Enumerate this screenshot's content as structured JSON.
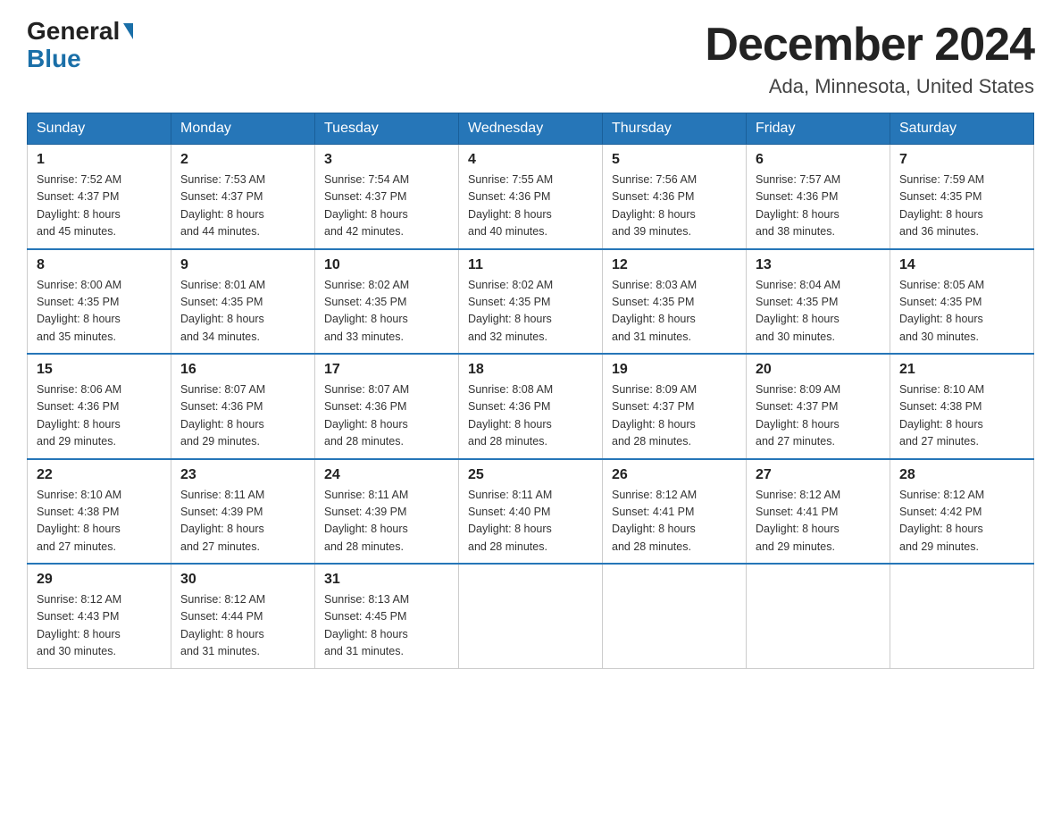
{
  "logo": {
    "general": "General",
    "blue": "Blue"
  },
  "header": {
    "month": "December 2024",
    "location": "Ada, Minnesota, United States"
  },
  "days_of_week": [
    "Sunday",
    "Monday",
    "Tuesday",
    "Wednesday",
    "Thursday",
    "Friday",
    "Saturday"
  ],
  "weeks": [
    [
      {
        "day": "1",
        "sunrise": "7:52 AM",
        "sunset": "4:37 PM",
        "daylight": "8 hours and 45 minutes."
      },
      {
        "day": "2",
        "sunrise": "7:53 AM",
        "sunset": "4:37 PM",
        "daylight": "8 hours and 44 minutes."
      },
      {
        "day": "3",
        "sunrise": "7:54 AM",
        "sunset": "4:37 PM",
        "daylight": "8 hours and 42 minutes."
      },
      {
        "day": "4",
        "sunrise": "7:55 AM",
        "sunset": "4:36 PM",
        "daylight": "8 hours and 40 minutes."
      },
      {
        "day": "5",
        "sunrise": "7:56 AM",
        "sunset": "4:36 PM",
        "daylight": "8 hours and 39 minutes."
      },
      {
        "day": "6",
        "sunrise": "7:57 AM",
        "sunset": "4:36 PM",
        "daylight": "8 hours and 38 minutes."
      },
      {
        "day": "7",
        "sunrise": "7:59 AM",
        "sunset": "4:35 PM",
        "daylight": "8 hours and 36 minutes."
      }
    ],
    [
      {
        "day": "8",
        "sunrise": "8:00 AM",
        "sunset": "4:35 PM",
        "daylight": "8 hours and 35 minutes."
      },
      {
        "day": "9",
        "sunrise": "8:01 AM",
        "sunset": "4:35 PM",
        "daylight": "8 hours and 34 minutes."
      },
      {
        "day": "10",
        "sunrise": "8:02 AM",
        "sunset": "4:35 PM",
        "daylight": "8 hours and 33 minutes."
      },
      {
        "day": "11",
        "sunrise": "8:02 AM",
        "sunset": "4:35 PM",
        "daylight": "8 hours and 32 minutes."
      },
      {
        "day": "12",
        "sunrise": "8:03 AM",
        "sunset": "4:35 PM",
        "daylight": "8 hours and 31 minutes."
      },
      {
        "day": "13",
        "sunrise": "8:04 AM",
        "sunset": "4:35 PM",
        "daylight": "8 hours and 30 minutes."
      },
      {
        "day": "14",
        "sunrise": "8:05 AM",
        "sunset": "4:35 PM",
        "daylight": "8 hours and 30 minutes."
      }
    ],
    [
      {
        "day": "15",
        "sunrise": "8:06 AM",
        "sunset": "4:36 PM",
        "daylight": "8 hours and 29 minutes."
      },
      {
        "day": "16",
        "sunrise": "8:07 AM",
        "sunset": "4:36 PM",
        "daylight": "8 hours and 29 minutes."
      },
      {
        "day": "17",
        "sunrise": "8:07 AM",
        "sunset": "4:36 PM",
        "daylight": "8 hours and 28 minutes."
      },
      {
        "day": "18",
        "sunrise": "8:08 AM",
        "sunset": "4:36 PM",
        "daylight": "8 hours and 28 minutes."
      },
      {
        "day": "19",
        "sunrise": "8:09 AM",
        "sunset": "4:37 PM",
        "daylight": "8 hours and 28 minutes."
      },
      {
        "day": "20",
        "sunrise": "8:09 AM",
        "sunset": "4:37 PM",
        "daylight": "8 hours and 27 minutes."
      },
      {
        "day": "21",
        "sunrise": "8:10 AM",
        "sunset": "4:38 PM",
        "daylight": "8 hours and 27 minutes."
      }
    ],
    [
      {
        "day": "22",
        "sunrise": "8:10 AM",
        "sunset": "4:38 PM",
        "daylight": "8 hours and 27 minutes."
      },
      {
        "day": "23",
        "sunrise": "8:11 AM",
        "sunset": "4:39 PM",
        "daylight": "8 hours and 27 minutes."
      },
      {
        "day": "24",
        "sunrise": "8:11 AM",
        "sunset": "4:39 PM",
        "daylight": "8 hours and 28 minutes."
      },
      {
        "day": "25",
        "sunrise": "8:11 AM",
        "sunset": "4:40 PM",
        "daylight": "8 hours and 28 minutes."
      },
      {
        "day": "26",
        "sunrise": "8:12 AM",
        "sunset": "4:41 PM",
        "daylight": "8 hours and 28 minutes."
      },
      {
        "day": "27",
        "sunrise": "8:12 AM",
        "sunset": "4:41 PM",
        "daylight": "8 hours and 29 minutes."
      },
      {
        "day": "28",
        "sunrise": "8:12 AM",
        "sunset": "4:42 PM",
        "daylight": "8 hours and 29 minutes."
      }
    ],
    [
      {
        "day": "29",
        "sunrise": "8:12 AM",
        "sunset": "4:43 PM",
        "daylight": "8 hours and 30 minutes."
      },
      {
        "day": "30",
        "sunrise": "8:12 AM",
        "sunset": "4:44 PM",
        "daylight": "8 hours and 31 minutes."
      },
      {
        "day": "31",
        "sunrise": "8:13 AM",
        "sunset": "4:45 PM",
        "daylight": "8 hours and 31 minutes."
      },
      null,
      null,
      null,
      null
    ]
  ],
  "labels": {
    "sunrise": "Sunrise:",
    "sunset": "Sunset:",
    "daylight": "Daylight:"
  }
}
